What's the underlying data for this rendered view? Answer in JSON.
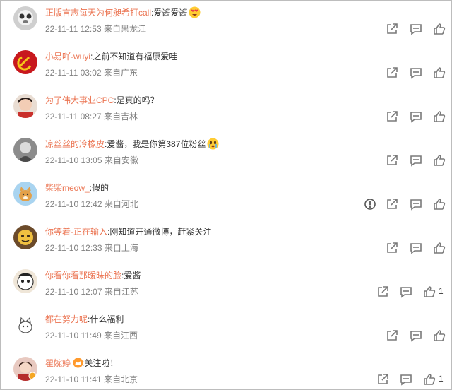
{
  "colors": {
    "username": "#eb7350",
    "text": "#333333",
    "meta": "#808080",
    "icon": "#7a7a7a"
  },
  "comments": [
    {
      "user": "正版言志每天为何昶希打call",
      "text": ":爱酱爱酱",
      "emoji": "heart-eyes-emoji",
      "meta": "22-11-11 12:53 来自黑龙江",
      "like_count": "",
      "report": false
    },
    {
      "user": "小易吖-wuyi",
      "text": ":之前不知道有福原爱哇",
      "emoji": "",
      "meta": "22-11-11 03:02 来自广东",
      "like_count": "",
      "report": false
    },
    {
      "user": "为了伟大事业CPC",
      "text": ":是真的吗？",
      "emoji": "",
      "meta": "22-11-11 08:27 来自吉林",
      "like_count": "",
      "report": false
    },
    {
      "user": "凉丝丝的冷橡皮",
      "text": ":爱酱，我是你第387位粉丝",
      "emoji": "tearful-emoji",
      "meta": "22-11-10 13:05 来自安徽",
      "like_count": "",
      "report": false
    },
    {
      "user": "柴柴meow_",
      "text": ":假的",
      "emoji": "",
      "meta": "22-11-10 12:42 来自河北",
      "like_count": "",
      "report": true
    },
    {
      "user": "你等着-正在输入",
      "text": ":刚知道开通微博，赶紧关注",
      "emoji": "",
      "meta": "22-11-10 12:33 来自上海",
      "like_count": "",
      "report": false
    },
    {
      "user": "你看你看那暧昧的脸",
      "text": ":爱酱",
      "emoji": "",
      "meta": "22-11-10 12:07 来自江苏",
      "like_count": "1",
      "report": false
    },
    {
      "user": "都在努力呢",
      "text": ":什么福利",
      "emoji": "",
      "meta": "22-11-10 11:49 来自江西",
      "like_count": "",
      "report": false
    },
    {
      "user": "瞿婉婷",
      "text": ":关注啦！",
      "emoji": "",
      "badge": true,
      "meta": "22-11-10 11:41 来自北京",
      "like_count": "1",
      "report": false
    }
  ]
}
